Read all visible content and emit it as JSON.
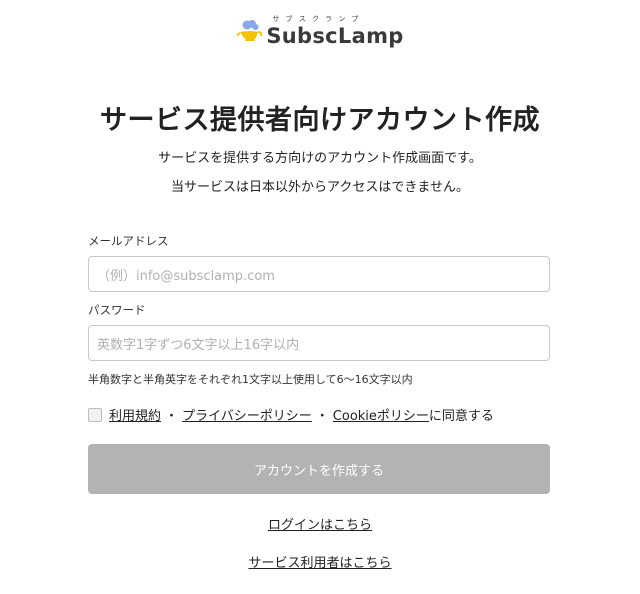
{
  "logo": {
    "ruby": "サブスクランプ",
    "name": "SubscLamp",
    "icon": "lamp-logo-icon",
    "colors": {
      "cloud": "#8aa8e6",
      "lamp": "#f5c400"
    }
  },
  "page": {
    "title": "サービス提供者向けアカウント作成",
    "description_1": "サービスを提供する方向けのアカウント作成画面です。",
    "description_2": "当サービスは日本以外からアクセスはできません。"
  },
  "form": {
    "email_label": "メールアドレス",
    "email_placeholder": "（例）info@subsclamp.com",
    "password_label": "パスワード",
    "password_placeholder": "英数字1字ずつ6文字以上16字以内",
    "password_hint": "半角数字と半角英字をそれぞれ1文字以上使用して6〜16文字以内",
    "agree": {
      "terms": "利用規約",
      "sep1": "・",
      "privacy": "プライバシーポリシー",
      "sep2": "・",
      "cookie": "Cookieポリシー",
      "suffix": "に同意する",
      "checked": false
    },
    "submit_label": "アカウントを作成する",
    "submit_color": "#b3b3b3"
  },
  "links": {
    "login": "ログインはこちら",
    "user": "サービス利用者はこちら"
  }
}
